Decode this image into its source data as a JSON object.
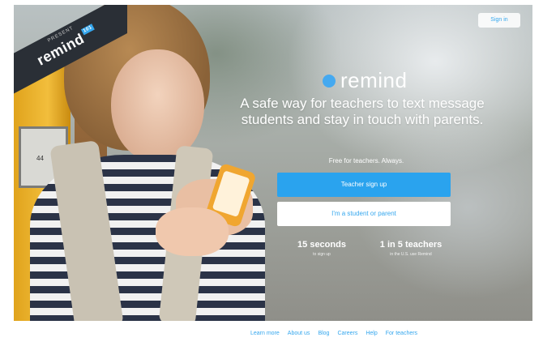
{
  "ribbon": {
    "small_text": "PRESENT",
    "logo_text": "remind",
    "badge": "101"
  },
  "header": {
    "signin_label": "Sign in"
  },
  "brand": {
    "name": "remind",
    "accent_color": "#35a7ee"
  },
  "hero": {
    "tagline": "A safe way for teachers to text message students and stay in touch with parents.",
    "free_text": "Free for teachers. Always.",
    "primary_button": "Teacher sign up",
    "secondary_button": "I'm a student or parent",
    "bus_number": "44"
  },
  "stats": [
    {
      "main": "15 seconds",
      "sub": "to sign up"
    },
    {
      "main": "1 in 5 teachers",
      "sub": "in the U.S. use Remind"
    }
  ],
  "footer": {
    "links": [
      "Learn more",
      "About us",
      "Blog",
      "Careers",
      "Help",
      "For teachers"
    ]
  }
}
